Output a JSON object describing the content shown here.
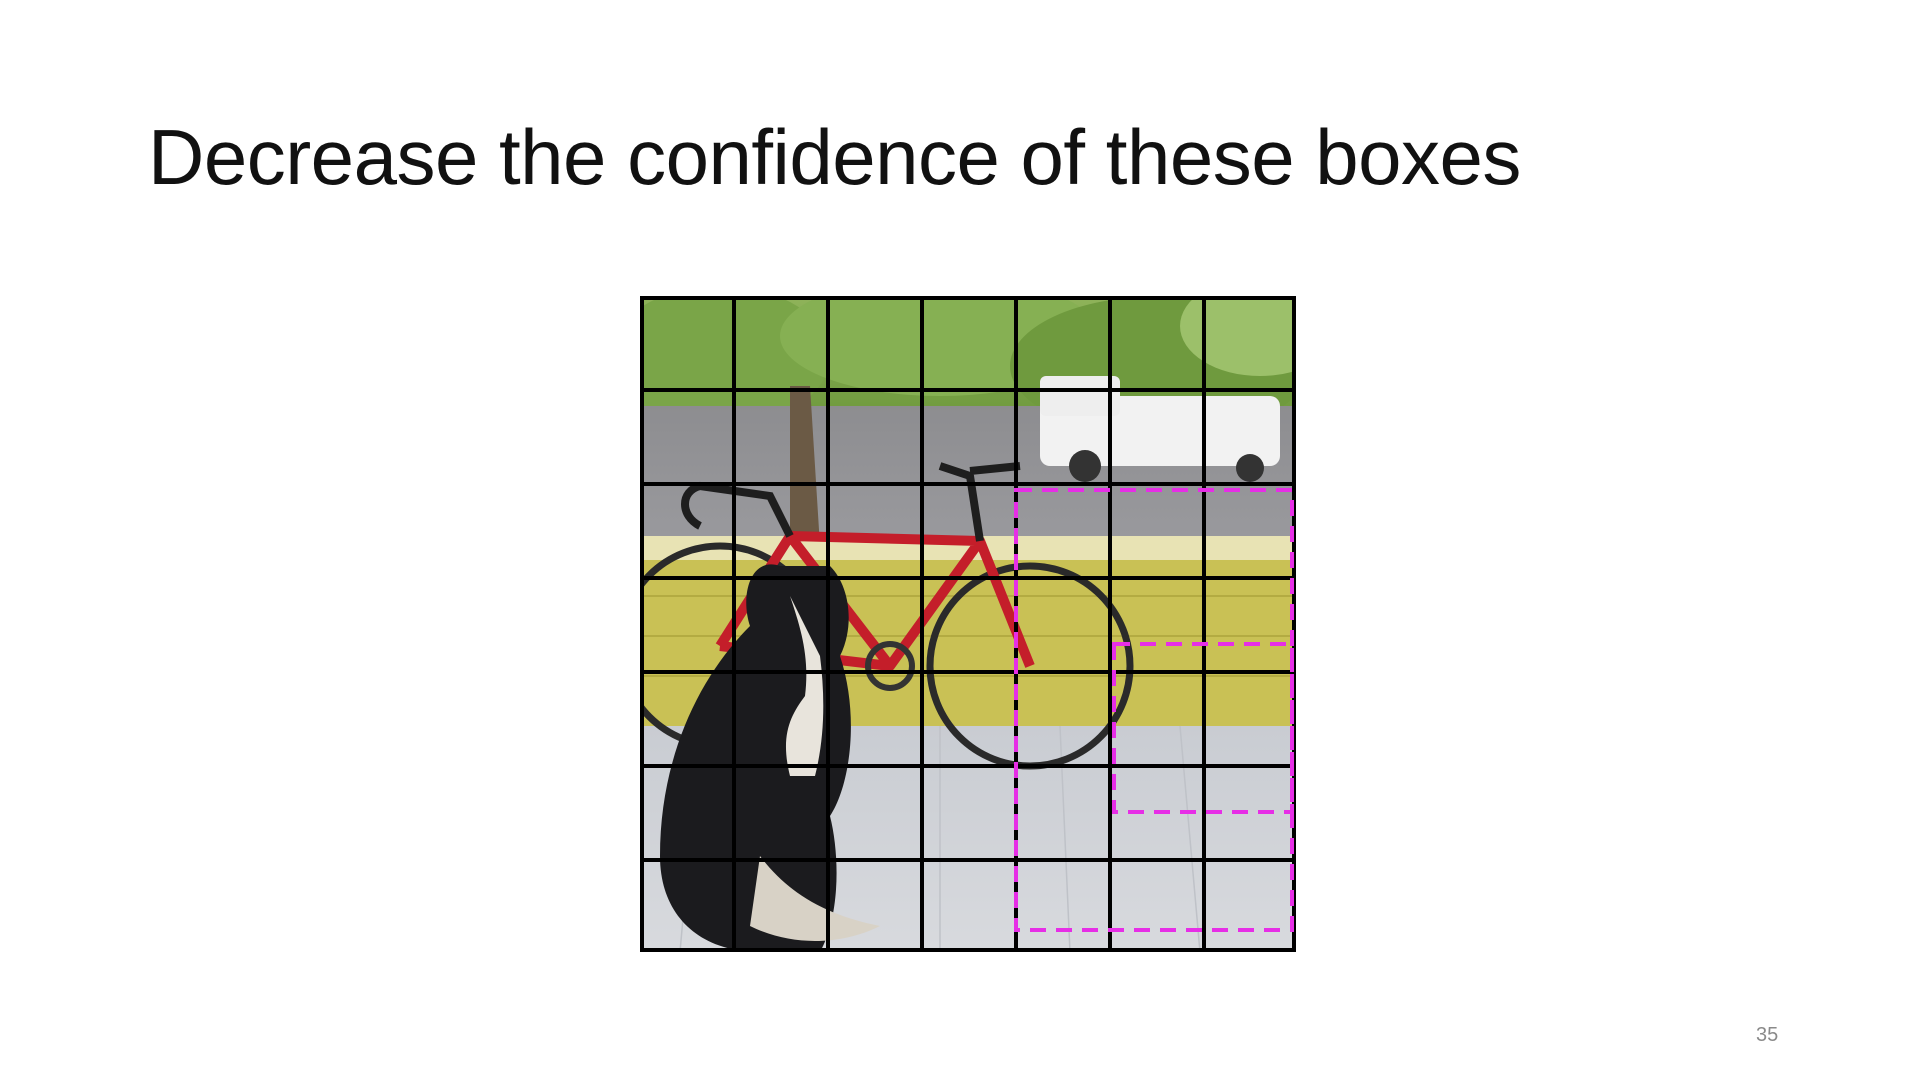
{
  "slide": {
    "title": "Decrease the confidence of these boxes",
    "page_number": "35"
  },
  "figure": {
    "grid": {
      "rows": 7,
      "cols": 7
    },
    "box_color": "#e62ee6",
    "grid_color": "#000000"
  }
}
